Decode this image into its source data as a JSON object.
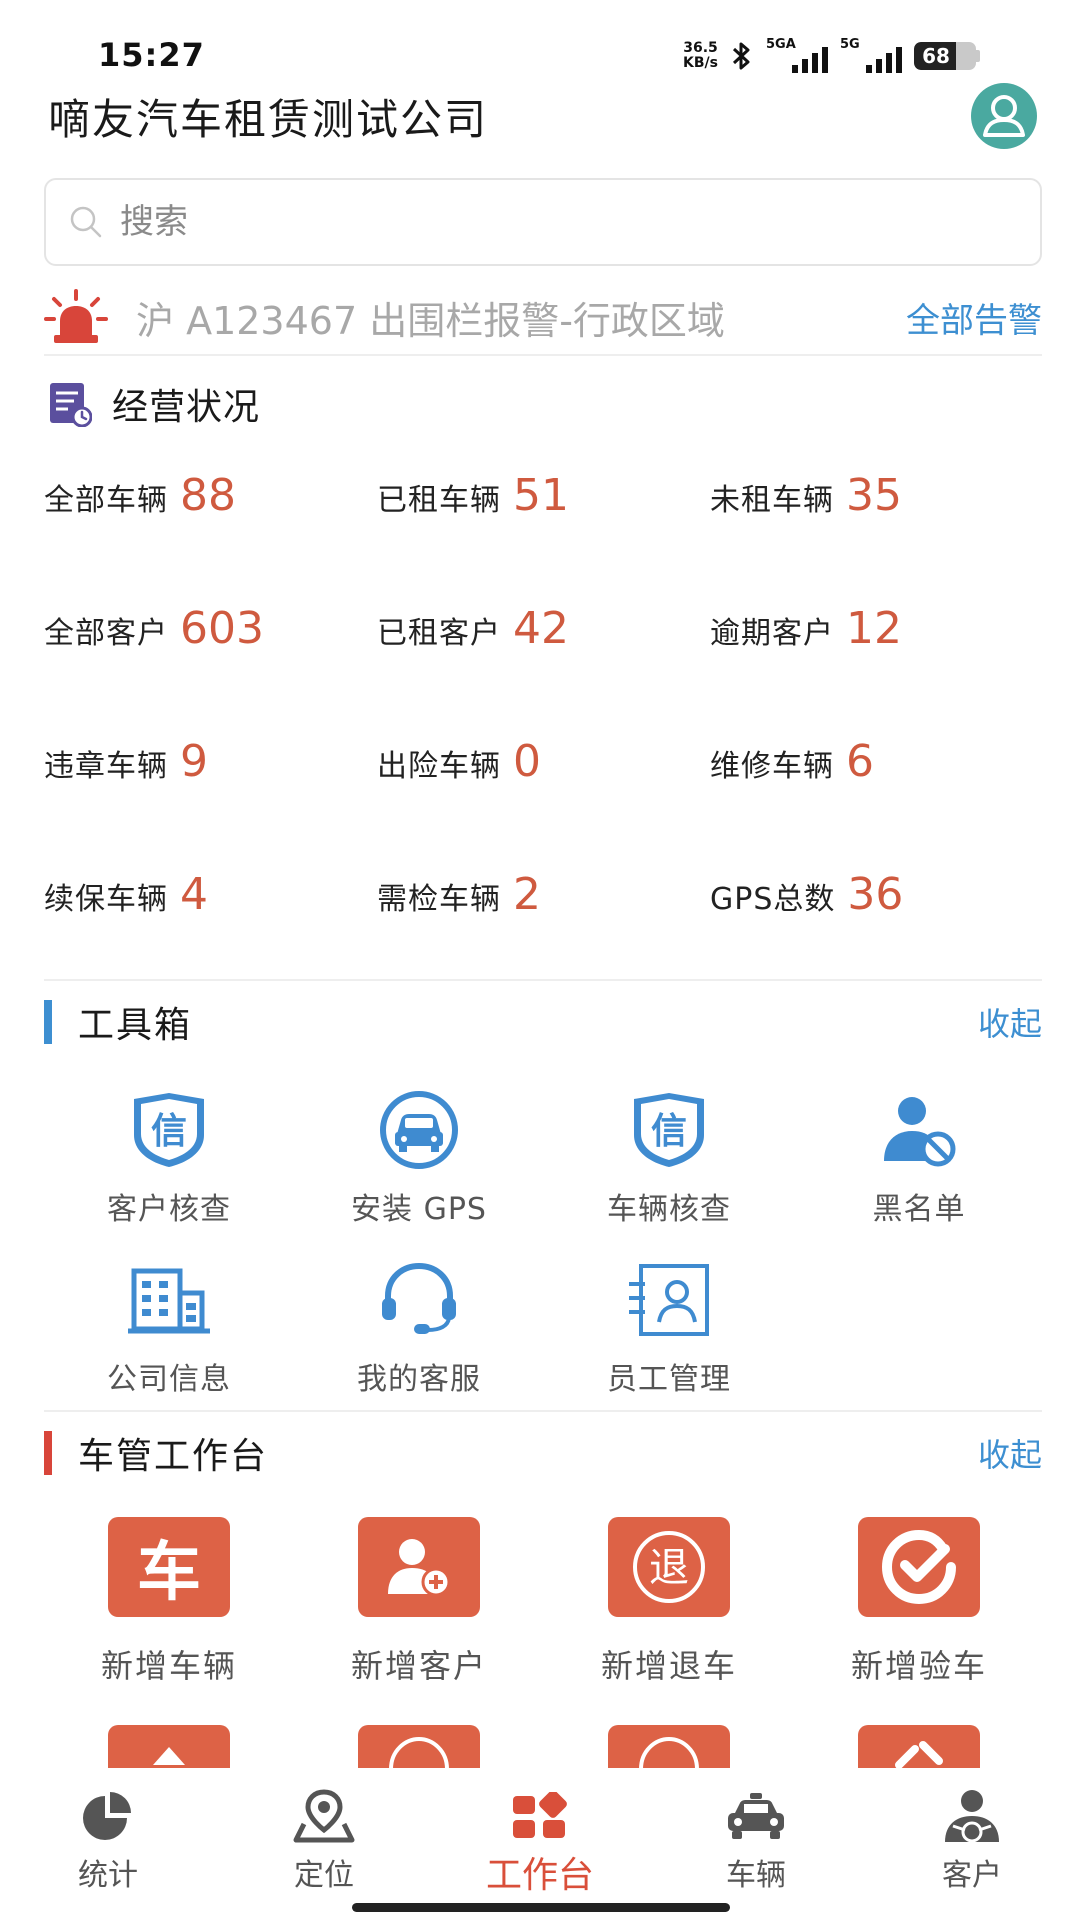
{
  "status_bar": {
    "time": "15:27",
    "net_speed_value": "36.5",
    "net_speed_unit": "KB/s",
    "signal1_label": "5GA",
    "signal2_label": "5G",
    "battery": "68",
    "battery_level": 0.68
  },
  "header": {
    "title": "嘀友汽车租赁测试公司"
  },
  "search": {
    "placeholder": "搜索"
  },
  "alarm": {
    "text": "沪 A123467 出围栏报警-行政区域",
    "link": "全部告警"
  },
  "business": {
    "title": "经营状况",
    "stats": [
      [
        {
          "label": "全部车辆",
          "value": "88"
        },
        {
          "label": "已租车辆",
          "value": "51"
        },
        {
          "label": "未租车辆",
          "value": "35"
        }
      ],
      [
        {
          "label": "全部客户",
          "value": "603"
        },
        {
          "label": "已租客户",
          "value": "42"
        },
        {
          "label": "逾期客户",
          "value": "12"
        }
      ],
      [
        {
          "label": "违章车辆",
          "value": "9"
        },
        {
          "label": "出险车辆",
          "value": "0"
        },
        {
          "label": "维修车辆",
          "value": "6"
        }
      ],
      [
        {
          "label": "续保车辆",
          "value": "4"
        },
        {
          "label": "需检车辆",
          "value": "2"
        },
        {
          "label": "GPS总数",
          "value": "36"
        }
      ]
    ]
  },
  "toolbox": {
    "title": "工具箱",
    "collapse": "收起",
    "items": [
      {
        "label": "客户核查",
        "icon": "shield-xin-icon"
      },
      {
        "label": "安装 GPS",
        "icon": "car-gps-icon"
      },
      {
        "label": "车辆核查",
        "icon": "shield-xin-icon"
      },
      {
        "label": "黑名单",
        "icon": "user-block-icon"
      },
      {
        "label": "公司信息",
        "icon": "building-icon"
      },
      {
        "label": "我的客服",
        "icon": "headset-icon"
      },
      {
        "label": "员工管理",
        "icon": "staff-card-icon"
      }
    ],
    "shield_glyph": "信"
  },
  "car_mgmt": {
    "title": "车管工作台",
    "collapse": "收起",
    "items": [
      {
        "label": "新增车辆",
        "glyph": "车"
      },
      {
        "label": "新增客户",
        "glyph": ""
      },
      {
        "label": "新增退车",
        "glyph": "退"
      },
      {
        "label": "新增验车",
        "glyph": ""
      }
    ]
  },
  "nav": {
    "items": [
      {
        "label": "统计"
      },
      {
        "label": "定位"
      },
      {
        "label": "工作台"
      },
      {
        "label": "车辆"
      },
      {
        "label": "客户"
      }
    ]
  },
  "colors": {
    "accent_orange": "#dd6246",
    "value_orange": "#cf5a3f",
    "link_blue": "#3d8fd1",
    "icon_blue": "#3f8bd0",
    "nav_active": "#d94f3a",
    "toolbox_bar": "#3d8fd1",
    "carmgmt_bar": "#d8453a"
  }
}
